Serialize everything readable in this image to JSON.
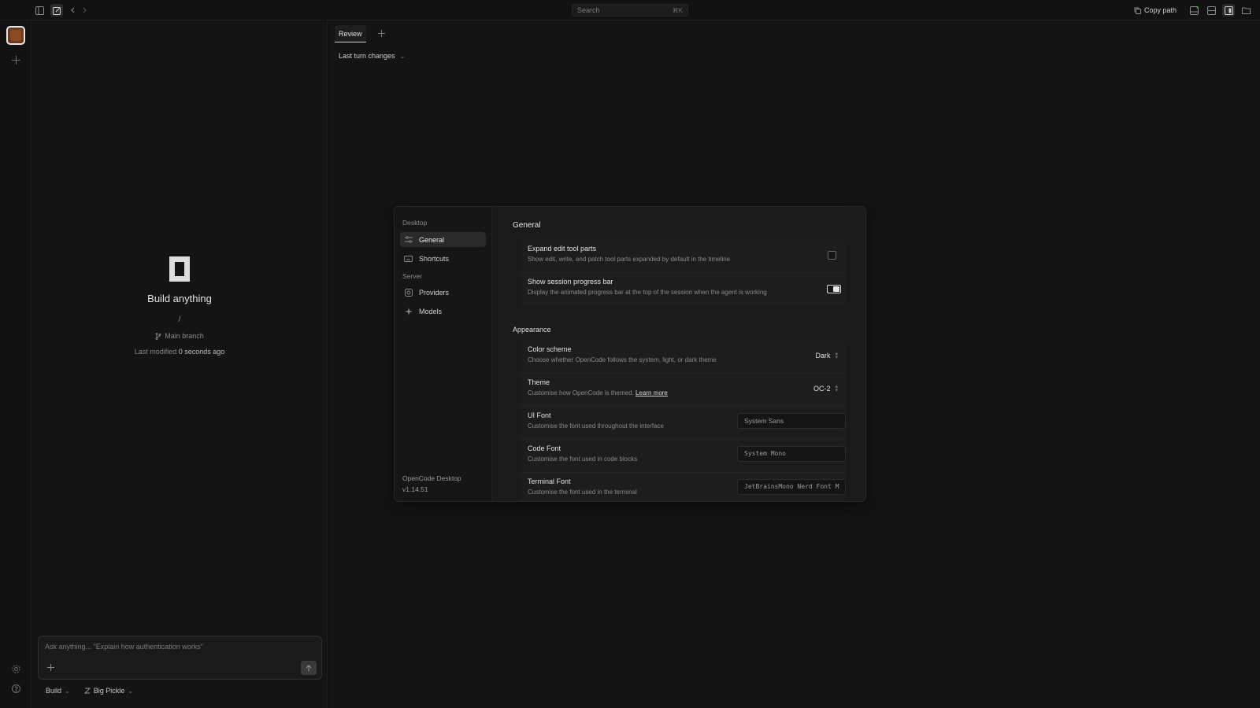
{
  "topbar": {
    "search_placeholder": "Search",
    "search_shortcut": "⌘K",
    "copy_path_label": "Copy path"
  },
  "session": {
    "empty_title": "Build anything",
    "path_separator": "/",
    "branch_label": "Main branch",
    "modified_prefix": "Last modified",
    "modified_value": "0 seconds ago",
    "composer_placeholder": "Ask anything... \"Explain how authentication works\"",
    "agent_label": "Build",
    "model_label": "Big Pickle"
  },
  "review": {
    "tab_label": "Review",
    "turn_select_label": "Last turn changes"
  },
  "settings": {
    "sidebar": {
      "group_desktop": "Desktop",
      "group_server": "Server",
      "items": [
        {
          "label": "General",
          "icon": "sliders-icon",
          "active": true
        },
        {
          "label": "Shortcuts",
          "icon": "keyboard-icon",
          "active": false
        },
        {
          "label": "Providers",
          "icon": "providers-icon",
          "active": false
        },
        {
          "label": "Models",
          "icon": "sparkle-icon",
          "active": false
        }
      ],
      "app_name": "OpenCode Desktop",
      "version": "v1.14.51"
    },
    "title": "General",
    "general_rows": [
      {
        "title": "Expand edit tool parts",
        "desc": "Show edit, write, and patch tool parts expanded by default in the timeline",
        "checked": false
      },
      {
        "title": "Show session progress bar",
        "desc": "Display the animated progress bar at the top of the session when the agent is working",
        "checked": true
      }
    ],
    "appearance_title": "Appearance",
    "appearance_rows": {
      "color_scheme": {
        "title": "Color scheme",
        "desc": "Choose whether OpenCode follows the system, light, or dark theme",
        "value": "Dark"
      },
      "theme": {
        "title": "Theme",
        "desc": "Customise how OpenCode is themed.",
        "link": "Learn more",
        "value": "OC-2"
      },
      "ui_font": {
        "title": "UI Font",
        "desc": "Customise the font used throughout the interface",
        "placeholder": "System Sans"
      },
      "code_font": {
        "title": "Code Font",
        "desc": "Customise the font used in code blocks",
        "placeholder": "System Mono"
      },
      "terminal_font": {
        "title": "Terminal Font",
        "desc": "Customise the font used in the terminal",
        "placeholder": "JetBrainsMono Nerd Font M"
      }
    }
  },
  "colors": {
    "background": "#101010",
    "panel": "#141414",
    "dialog": "#1a1a1a",
    "accent_project": "#6b3a1e"
  }
}
